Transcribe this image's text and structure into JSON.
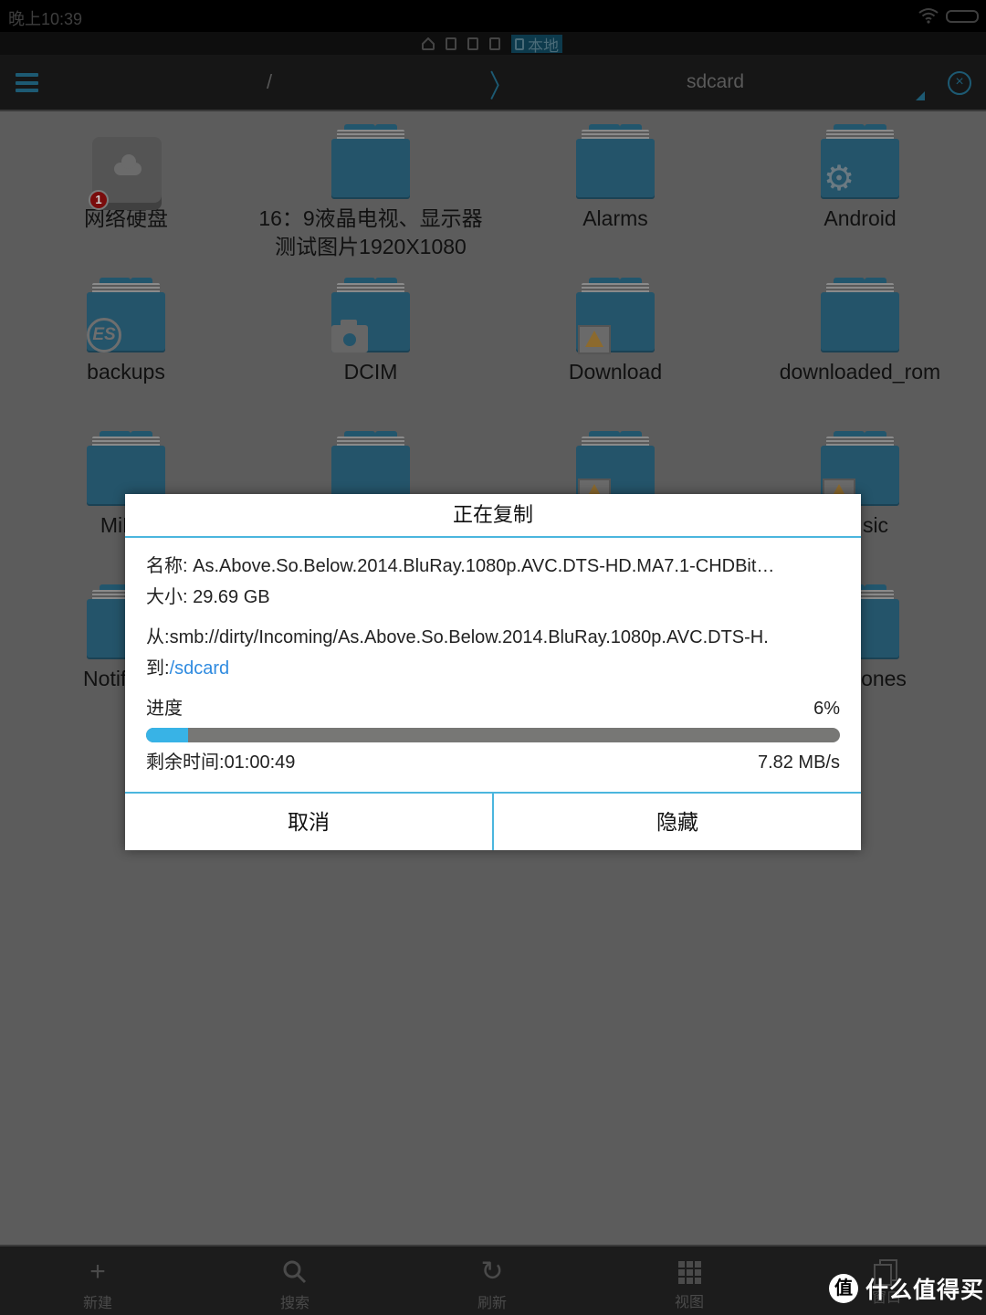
{
  "status_bar": {
    "time": "晚上10:39",
    "icons": [
      "wifi-icon",
      "battery-icon"
    ]
  },
  "location_tabs": {
    "icons": [
      "home-icon",
      "phone-icon",
      "devices-icon",
      "network-icon"
    ],
    "active_label": "本地"
  },
  "toolbar": {
    "menu_icon": "menu-icon",
    "breadcrumb_root": "/",
    "breadcrumb_separator": "〉",
    "breadcrumb_current": "sdcard",
    "close_icon_glyph": "×"
  },
  "files": [
    {
      "name": "网络硬盘",
      "type": "network-drive",
      "badge_count": "1"
    },
    {
      "name": "16：9液晶电视、显示器\n测试图片1920X1080",
      "line1": "16：9液晶电视、显示器",
      "line2": "测试图片1920X1080",
      "type": "folder"
    },
    {
      "name": "Alarms",
      "type": "folder"
    },
    {
      "name": "Android",
      "type": "folder",
      "overlay": "gear-icon"
    },
    {
      "name": "backups",
      "type": "folder",
      "overlay": "es-logo-icon",
      "overlay_text": "ES"
    },
    {
      "name": "DCIM",
      "type": "folder",
      "overlay": "camera-icon"
    },
    {
      "name": "Download",
      "type": "folder",
      "overlay": "image-warning-icon"
    },
    {
      "name": "downloaded_rom",
      "type": "folder"
    },
    {
      "name": "MiMa",
      "type": "folder",
      "partially_hidden": true
    },
    {
      "name": "",
      "type": "folder",
      "partially_hidden": true
    },
    {
      "name": "",
      "type": "folder",
      "overlay": "image-warning-icon",
      "partially_hidden": true
    },
    {
      "name": "sic",
      "type": "folder",
      "overlay": "image-warning-icon",
      "partially_hidden": true
    },
    {
      "name": "Notific",
      "type": "folder",
      "partially_hidden": true
    },
    {
      "name": "ones",
      "type": "folder",
      "partially_hidden": true
    }
  ],
  "dialog": {
    "title": "正在复制",
    "name_label": "名称: ",
    "name_value": "As.Above.So.Below.2014.BluRay.1080p.AVC.DTS-HD.MA7.1-CHDBit…",
    "size_label": "大小: ",
    "size_value": "29.69 GB",
    "from_label": "从:",
    "from_value": "smb://dirty/Incoming/As.Above.So.Below.2014.BluRay.1080p.AVC.DTS-H.",
    "to_label": "到:",
    "to_value": "/sdcard",
    "progress_label": "进度",
    "progress_text": "6%",
    "progress_fraction": 0.06,
    "remaining_label": "剩余时间:",
    "remaining_value": "01:00:49",
    "speed": "7.82 MB/s",
    "cancel_label": "取消",
    "hide_label": "隐藏"
  },
  "bottom_bar": {
    "items": [
      {
        "label": "新建",
        "icon": "plus-icon",
        "glyph": "+"
      },
      {
        "label": "搜索",
        "icon": "search-icon",
        "glyph": "⚲"
      },
      {
        "label": "刷新",
        "icon": "refresh-icon",
        "glyph": "↻"
      },
      {
        "label": "视图",
        "icon": "grid-view-icon"
      },
      {
        "label": "窗口",
        "icon": "windows-icon"
      }
    ]
  },
  "watermark": {
    "logo_char": "值",
    "text": "什么值得买"
  },
  "colors": {
    "accent": "#38b3e6",
    "dialog_divider": "#4bb6de",
    "link": "#2f8be0",
    "folder": "#24546a",
    "overlay_dim": "#5c5c5c"
  }
}
